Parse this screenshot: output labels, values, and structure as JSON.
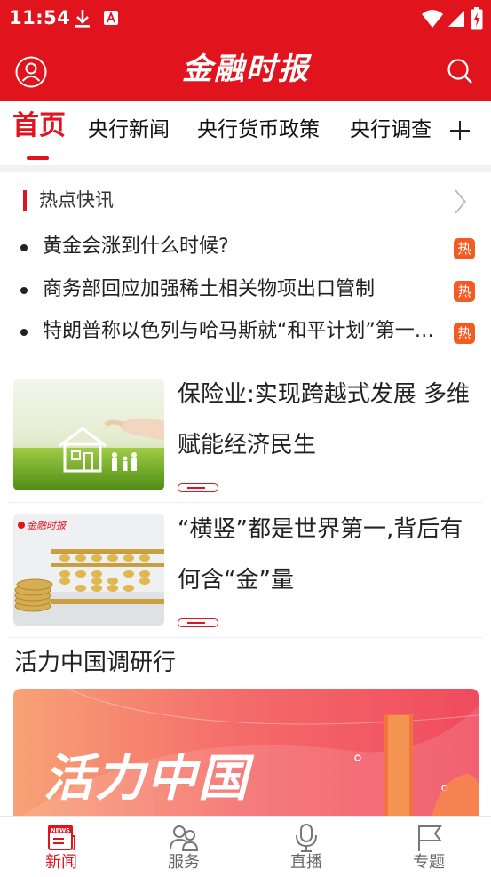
{
  "status_bar": {
    "time": "11:54"
  },
  "header": {
    "logo_text": "金融时报"
  },
  "channels": {
    "tabs": [
      {
        "label": "首页",
        "active": true
      },
      {
        "label": "央行新闻"
      },
      {
        "label": "央行货币政策"
      },
      {
        "label": "央行调查"
      }
    ],
    "add_label": "+"
  },
  "hot": {
    "title": "热点快讯",
    "items": [
      {
        "text": "黄金会涨到什么时候?",
        "badge": "热"
      },
      {
        "text": "商务部回应加强稀土相关物项出口管制",
        "badge": "热"
      },
      {
        "text": "特朗普称以色列与哈马斯就“和平计划”第一阶段达成一致",
        "badge": "热"
      }
    ]
  },
  "news": [
    {
      "headline": "保险业:实现跨越式发展 多维赋能经济民生",
      "thumb_caption": ""
    },
    {
      "headline": "“横竖”都是世界第一,背后有何含“金”量",
      "thumb_caption": "金融时报"
    }
  ],
  "section": {
    "title": "活力中国调研行"
  },
  "banner": {
    "text": "活力中国"
  },
  "bottom_nav": {
    "items": [
      {
        "label": "新闻",
        "icon": "news-icon",
        "badge": "NEWS",
        "active": true
      },
      {
        "label": "服务",
        "icon": "service-icon"
      },
      {
        "label": "直播",
        "icon": "microphone-icon"
      },
      {
        "label": "专题",
        "icon": "flag-icon"
      }
    ]
  },
  "colors": {
    "brand_red": "#e1141e",
    "hot_badge": "#f45a24",
    "text_dark": "#222222",
    "nav_inactive": "#666666"
  }
}
